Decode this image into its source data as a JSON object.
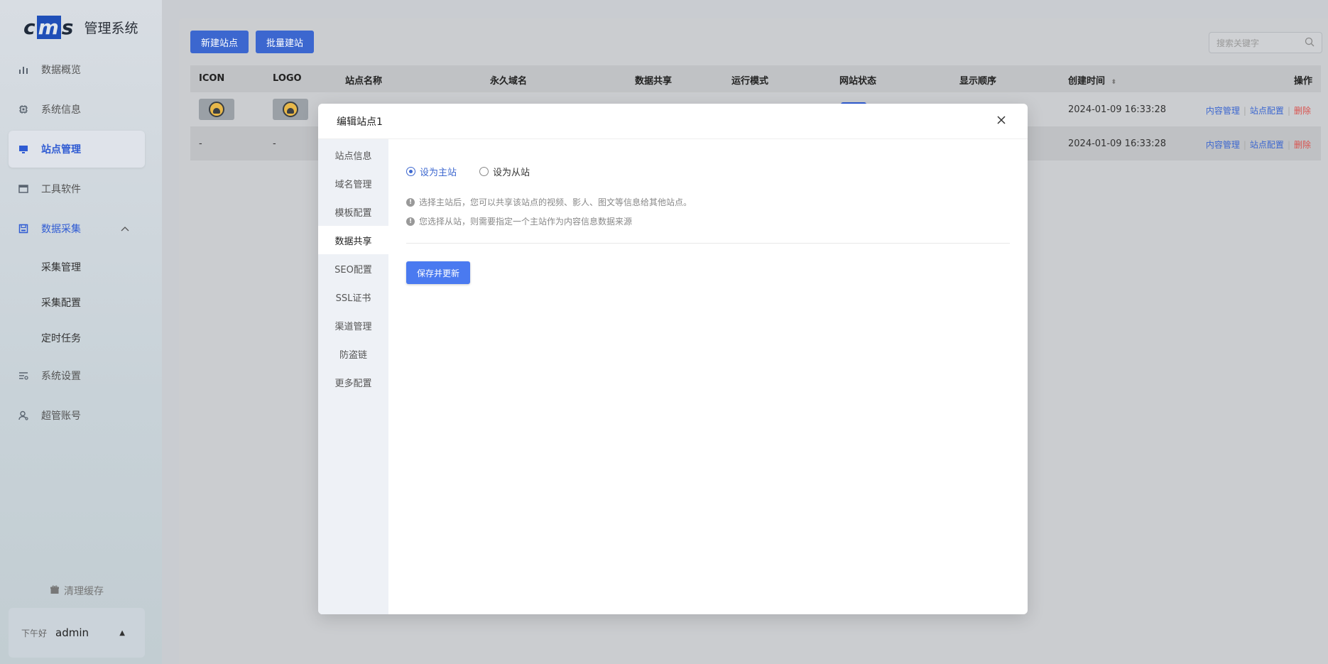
{
  "app": {
    "logo_text": "cms",
    "title": "管理系统"
  },
  "sidebar": {
    "items": [
      {
        "label": "数据概览",
        "icon": "bar-chart-icon"
      },
      {
        "label": "系统信息",
        "icon": "chip-icon"
      },
      {
        "label": "站点管理",
        "icon": "monitor-icon"
      },
      {
        "label": "工具软件",
        "icon": "window-icon"
      },
      {
        "label": "数据采集",
        "icon": "save-icon"
      },
      {
        "label": "系统设置",
        "icon": "settings-list-icon"
      },
      {
        "label": "超管账号",
        "icon": "user-icon"
      }
    ],
    "sub_items": [
      "采集管理",
      "采集配置",
      "定时任务"
    ],
    "cache_label": "清理缓存",
    "greeting": "下午好",
    "username": "admin"
  },
  "toolbar": {
    "new_site": "新建站点",
    "batch_site": "批量建站",
    "search_placeholder": "搜索关键字"
  },
  "table": {
    "headers": [
      "ICON",
      "LOGO",
      "站点名称",
      "永久域名",
      "数据共享",
      "运行模式",
      "网站状态",
      "显示顺序",
      "创建时间",
      "操作"
    ],
    "rows": [
      {
        "icon": "",
        "logo": "",
        "created": "2024-01-09 16:33:28"
      },
      {
        "icon": "-",
        "logo": "-",
        "created": "2024-01-09 16:33:28"
      }
    ],
    "actions": {
      "content": "内容管理",
      "config": "站点配置",
      "delete": "删除"
    }
  },
  "modal": {
    "title": "编辑站点1",
    "tabs": [
      "站点信息",
      "域名管理",
      "模板配置",
      "数据共享",
      "SEO配置",
      "SSL证书",
      "渠道管理",
      "防盗链",
      "更多配置"
    ],
    "active_tab": "数据共享",
    "radio_main": "设为主站",
    "radio_sub": "设为从站",
    "tip1": "选择主站后，您可以共享该站点的视频、影人、图文等信息给其他站点。",
    "tip2": "您选择从站，则需要指定一个主站作为内容信息数据来源",
    "save_label": "保存并更新"
  },
  "colors": {
    "accent": "#3c67cf",
    "danger": "#d9534f"
  }
}
